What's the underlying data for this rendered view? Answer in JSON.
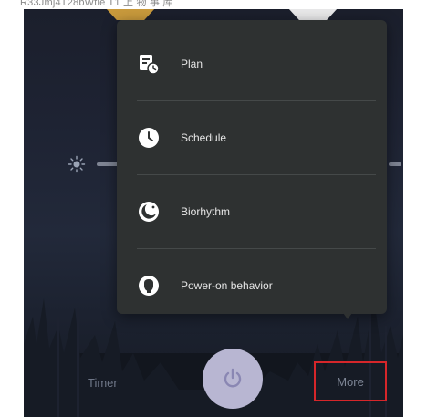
{
  "caption": "R33Jmj4T28bWtle T1 上 物 事 库",
  "menu": {
    "items": [
      {
        "label": "Plan",
        "icon": "plan-icon"
      },
      {
        "label": "Schedule",
        "icon": "clock-icon"
      },
      {
        "label": "Biorhythm",
        "icon": "biorhythm-icon"
      },
      {
        "label": "Power-on behavior",
        "icon": "power-on-behavior-icon"
      }
    ]
  },
  "bottom_bar": {
    "timer_label": "Timer",
    "power_icon": "power-icon",
    "more_label": "More"
  },
  "brightness": {
    "icon": "sun-icon",
    "right_label": ""
  },
  "colors": {
    "menu_bg": "#2e3131",
    "menu_text": "#e6e6e6",
    "power_button": "#b8b6d2",
    "highlight_border": "#d6262a",
    "amber_accent": "#c99a3c"
  }
}
